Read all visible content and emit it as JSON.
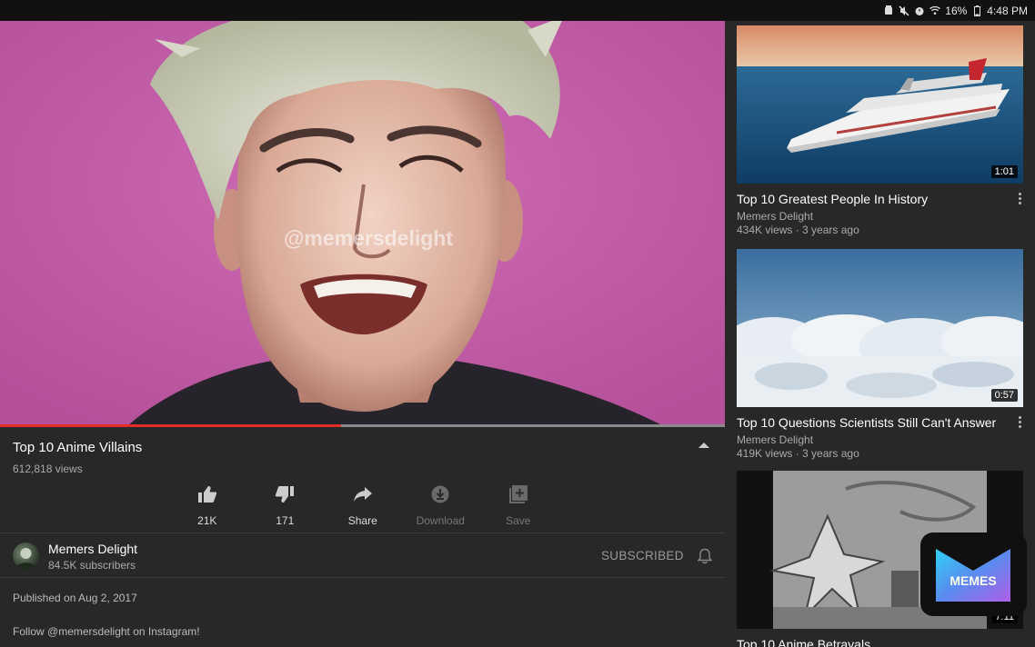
{
  "status_bar": {
    "battery": "16%",
    "time": "4:48 PM",
    "icons": [
      "alarm-icon",
      "mute-icon",
      "alarm-clock-icon",
      "wifi-icon",
      "battery-icon"
    ]
  },
  "player": {
    "watermark": "@memersdelight",
    "progress": 0.47,
    "progress_color": "#e52d27"
  },
  "video": {
    "title": "Top 10 Anime Villains",
    "views": "612,818 views"
  },
  "actions": {
    "like": "21K",
    "dislike": "171",
    "share": "Share",
    "download": "Download",
    "save": "Save"
  },
  "channel": {
    "name": "Memers Delight",
    "subscribers": "84.5K subscribers",
    "subscribed_label": "SUBSCRIBED"
  },
  "description": {
    "published": "Published on Aug 2, 2017",
    "text": "Follow @memersdelight on Instagram!"
  },
  "up_next": [
    {
      "title": "Top 10 Greatest People In History",
      "channel": "Memers Delight",
      "meta": "434K views · 3 years ago",
      "duration": "1:01"
    },
    {
      "title": "Top 10 Questions Scientists Still Can't Answer",
      "channel": "Memers Delight",
      "meta": "419K views · 3 years ago",
      "duration": "0:57"
    },
    {
      "title": "Top 10 Anime Betrayals",
      "duration": "7:11"
    }
  ],
  "overlay_logo": {
    "text": "MEMES"
  },
  "colors": {
    "background": "#282828",
    "accent": "#e52d27",
    "player_bg": "#c45ea9"
  }
}
